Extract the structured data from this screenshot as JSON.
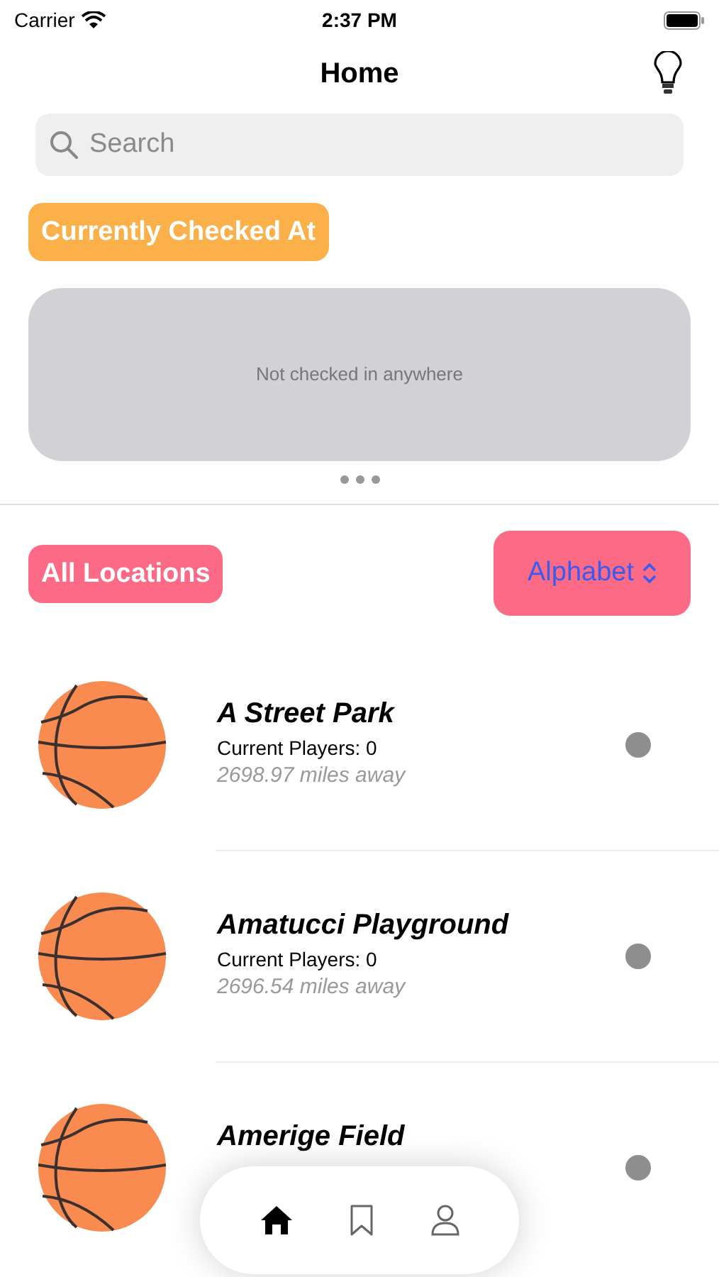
{
  "status_bar": {
    "carrier": "Carrier",
    "time": "2:37 PM"
  },
  "header": {
    "title": "Home"
  },
  "search": {
    "placeholder": "Search"
  },
  "checked_section": {
    "label": "Currently Checked At",
    "message": "Not checked in anywhere"
  },
  "filters": {
    "scope": "All Locations",
    "sort": "Alphabet"
  },
  "locations": [
    {
      "name": "A Street Park",
      "players": "Current Players: 0",
      "distance": "2698.97 miles away"
    },
    {
      "name": "Amatucci Playground",
      "players": "Current Players: 0",
      "distance": "2696.54 miles away"
    },
    {
      "name": "Amerige Field"
    }
  ],
  "tab_bar": [
    {
      "kind": "home",
      "selected": true
    },
    {
      "kind": "bookmark",
      "selected": false
    },
    {
      "kind": "profile",
      "selected": false
    }
  ]
}
